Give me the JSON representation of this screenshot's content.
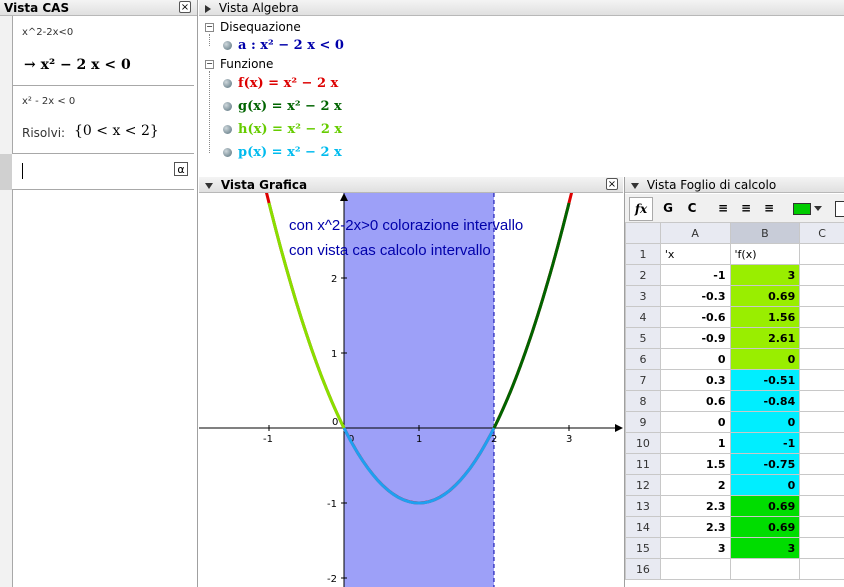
{
  "cas": {
    "title": "Vista CAS",
    "cells": [
      {
        "input": "x^2-2x<0",
        "output": "→  x² − 2 x < 0"
      },
      {
        "input": "x² - 2x < 0",
        "label": "Risolvi:",
        "output": "{0 < x < 2}"
      }
    ],
    "active_input": "",
    "alpha": "α"
  },
  "algebra": {
    "title": "Vista Algebra",
    "groups": [
      {
        "name": "Disequazione",
        "items": [
          {
            "text": "a : x² − 2 x < 0",
            "color": "#0000aa"
          }
        ]
      },
      {
        "name": "Funzione",
        "items": [
          {
            "text": "f(x) = x² − 2 x",
            "color": "#dd0000"
          },
          {
            "text": "g(x) = x² − 2 x",
            "color": "#006400"
          },
          {
            "text": "h(x) = x² − 2 x",
            "color": "#66cc00"
          },
          {
            "text": "p(x) = x² − 2 x",
            "color": "#00bbee"
          }
        ]
      }
    ]
  },
  "graphics": {
    "title": "Vista Grafica",
    "note1": "con x^2-2x>0 colorazione intervallo",
    "note2": "con vista cas calcolo intervallo",
    "x_ticks": [
      "-1",
      "0",
      "1",
      "2",
      "3"
    ],
    "y_ticks": [
      "2",
      "1",
      "0",
      "-1",
      "-2"
    ],
    "region_color": "#9da0f8"
  },
  "sheet": {
    "title": "Vista Foglio di calcolo",
    "toolbar": {
      "fx": "fx",
      "bold": "G",
      "italic": "C"
    },
    "columns": [
      "A",
      "B",
      "C"
    ],
    "rows": [
      {
        "n": "1",
        "a": "'x",
        "b": "'f(x)",
        "bg": ""
      },
      {
        "n": "2",
        "a": "-1",
        "b": "3",
        "bg": "#99ee00"
      },
      {
        "n": "3",
        "a": "-0.3",
        "b": "0.69",
        "bg": "#99ee00"
      },
      {
        "n": "4",
        "a": "-0.6",
        "b": "1.56",
        "bg": "#99ee00"
      },
      {
        "n": "5",
        "a": "-0.9",
        "b": "2.61",
        "bg": "#99ee00"
      },
      {
        "n": "6",
        "a": "0",
        "b": "0",
        "bg": "#99ee00"
      },
      {
        "n": "7",
        "a": "0.3",
        "b": "-0.51",
        "bg": "#00eeff"
      },
      {
        "n": "8",
        "a": "0.6",
        "b": "-0.84",
        "bg": "#00eeff"
      },
      {
        "n": "9",
        "a": "0",
        "b": "0",
        "bg": "#00eeff"
      },
      {
        "n": "10",
        "a": "1",
        "b": "-1",
        "bg": "#00eeff"
      },
      {
        "n": "11",
        "a": "1.5",
        "b": "-0.75",
        "bg": "#00eeff"
      },
      {
        "n": "12",
        "a": "2",
        "b": "0",
        "bg": "#00eeff"
      },
      {
        "n": "13",
        "a": "2.3",
        "b": "0.69",
        "bg": "#00dd00"
      },
      {
        "n": "14",
        "a": "2.3",
        "b": "0.69",
        "bg": "#00dd00"
      },
      {
        "n": "15",
        "a": "3",
        "b": "3",
        "bg": "#00dd00"
      },
      {
        "n": "16",
        "a": "",
        "b": "",
        "bg": ""
      }
    ]
  }
}
